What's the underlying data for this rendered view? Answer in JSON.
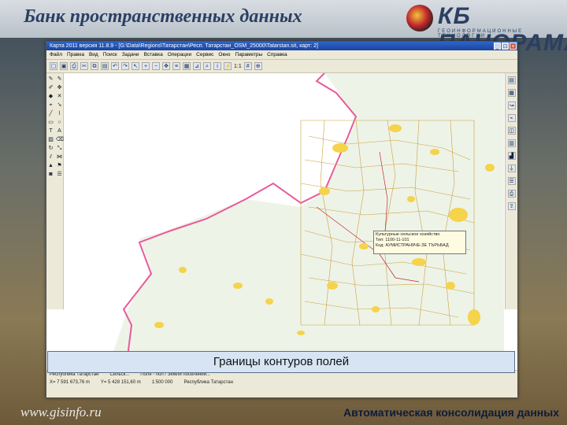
{
  "slide": {
    "title": "Банк пространственных данных",
    "caption": "Границы контуров полей",
    "footer_url": "www.gisinfo.ru",
    "footer_text": "Автоматическая консолидация данных"
  },
  "logo": {
    "text": "КБ ПАНОРАМА",
    "subtitle": "ГЕОИНФОРМАЦИОННЫЕ ТЕХНОЛОГИИ",
    "colors": {
      "primary": "#2b3f63",
      "accent": "#c2272d",
      "gold": "#f2c43a"
    }
  },
  "window": {
    "title": "Карта 2011 версия 11.8.9 - [G:\\Data\\Regions\\Татарстан\\Респ. Татарстан_OSM_25000\\Tatarstan.sit, карт: 2]",
    "controls": [
      "_",
      "□",
      "×"
    ],
    "menu": [
      "Файл",
      "Правка",
      "Вид",
      "Поиск",
      "Задачи",
      "Вставка",
      "Операции",
      "Сервис",
      "Окно",
      "Параметры",
      "Справка"
    ],
    "toolbar_icons": [
      "open-icon",
      "save-icon",
      "print-icon",
      "cut-icon",
      "copy-icon",
      "paste-icon",
      "undo-icon",
      "redo-icon",
      "select-icon",
      "zoom-in-icon",
      "zoom-out-icon",
      "pan-icon",
      "layers-icon",
      "legend-icon",
      "measure-icon",
      "search-icon",
      "info-icon",
      "lightning-icon",
      "grid-icon",
      "coords-icon"
    ],
    "zoom_label": "1:1",
    "left_tool_icons": [
      "pen-icon",
      "pen-icon",
      "edit-icon",
      "move-icon",
      "node-icon",
      "cross-icon",
      "snap-icon",
      "arrow-icon",
      "line-icon",
      "polyline-icon",
      "rect-icon",
      "circle-icon",
      "text-icon",
      "label-icon",
      "fill-icon",
      "erase-icon",
      "rotate-icon",
      "scale-icon",
      "split-icon",
      "merge-icon",
      "tri-icon",
      "flag-icon",
      "camera-icon",
      "layers-icon"
    ],
    "right_tool_icons": [
      "book-icon",
      "map-icon",
      "route-icon",
      "graph-icon",
      "db-icon",
      "table-icon",
      "chart-icon",
      "filter-icon",
      "list-icon",
      "print-icon",
      "export-icon"
    ],
    "tooltip_lines": [
      "Культурные сельское хозяйство",
      "Тип: 1100-11-101",
      "Код: АУМИСТРАН9ЧЕ-ЗЕ ТЪРЬБАД"
    ],
    "status": {
      "row1": [
        "Республика Татарстан",
        "Сельск...",
        "Поля - пол / Земли поселений..."
      ],
      "row2": [
        "X= 7 591 673,76 m",
        "Y= 5 428 151,60 m",
        "1:500 000",
        "Республика Татарстан"
      ]
    }
  }
}
